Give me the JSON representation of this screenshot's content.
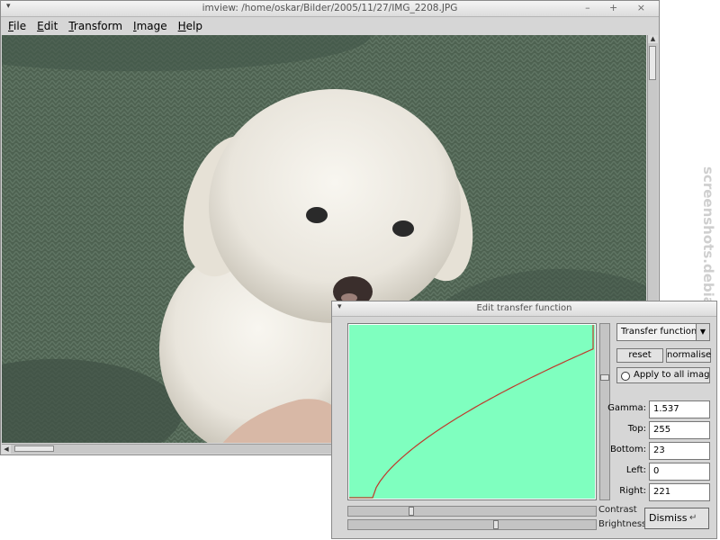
{
  "main_window": {
    "title": "imview: /home/oskar/Bilder/2005/11/27/IMG_2208.JPG",
    "titlebar_menu_glyph": "▾",
    "titlebar_controls": "– + ×",
    "menu": [
      "File",
      "Edit",
      "Transform",
      "Image",
      "Help"
    ],
    "menu_mnemonics": [
      "F",
      "E",
      "T",
      "I",
      "H"
    ]
  },
  "image": {
    "description_icon": "photo-of-white-puppy"
  },
  "watermark": "screenshots.debian.net",
  "dialog": {
    "title": "Edit transfer function",
    "titlebar_menu_glyph": "▾",
    "select_value": "Transfer function",
    "select_arrow": "▼",
    "reset_label": "reset",
    "normalise_label": "normalise",
    "apply_label": "Apply to all images",
    "fields": [
      {
        "label": "Gamma:",
        "value": "1.537"
      },
      {
        "label": "Top:",
        "value": "255"
      },
      {
        "label": "Bottom:",
        "value": "23"
      },
      {
        "label": "Left:",
        "value": "0"
      },
      {
        "label": "Right:",
        "value": "221"
      }
    ],
    "contrast_label": "Contrast",
    "brightness_label": "Brightness",
    "dismiss_label": "Dismiss",
    "dismiss_icon": "return-key-icon",
    "contrast_level": 0.25,
    "brightness_level": 0.6,
    "vslider_level": 0.3,
    "curve_color": "#c0392b",
    "curve_bg_color": "#7fffbf"
  },
  "chart_data": {
    "type": "line",
    "title": "",
    "xlabel": "",
    "ylabel": "",
    "xlim": [
      0,
      255
    ],
    "ylim": [
      0,
      255
    ],
    "series": [
      {
        "gamma": 1.537,
        "left": 0,
        "right": 221,
        "bottom": 23,
        "top": 255
      }
    ]
  }
}
